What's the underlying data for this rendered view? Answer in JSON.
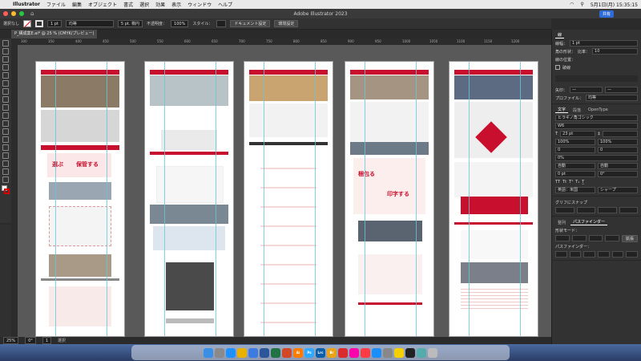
{
  "menubar": {
    "app_name": "Illustrator",
    "items": [
      "ファイル",
      "編集",
      "オブジェクト",
      "書式",
      "選択",
      "効果",
      "表示",
      "ウィンドウ",
      "ヘルプ"
    ],
    "clock": "5月1日(月) 15:35:15"
  },
  "window": {
    "title": "Adobe Illustrator 2023",
    "share_label": "共有"
  },
  "control_bar": {
    "selection": "選択なし",
    "stroke_weight": "1 pt",
    "stroke_profile": "均等",
    "brush": "5 pt. 楕円",
    "opacity_label": "不透明度：",
    "opacity": "100%",
    "style_label": "スタイル：",
    "doc_setup": "ドキュメント設定",
    "prefs": "環境設定"
  },
  "document_tab": {
    "label": "P_構成案E.ai* @ 25 % (CMYK/プレビュー)"
  },
  "ruler_marks": [
    "300",
    "350",
    "400",
    "450",
    "500",
    "550",
    "600",
    "650",
    "700",
    "750",
    "800",
    "850",
    "900",
    "950",
    "1000",
    "1050",
    "1100",
    "1150",
    "1200"
  ],
  "artboards": [
    {
      "name": "artboard-1",
      "headline": "選ぶ",
      "sub": "保管する"
    },
    {
      "name": "artboard-2",
      "headline": "",
      "sub": ""
    },
    {
      "name": "artboard-3",
      "headline": "",
      "sub": ""
    },
    {
      "name": "artboard-4",
      "headline": "梱包る",
      "sub": "印字する"
    },
    {
      "name": "artboard-5",
      "headline": "",
      "sub": ""
    }
  ],
  "status_bar": {
    "zoom": "25%",
    "rotation": "0°",
    "artboard_num": "1",
    "tool": "選択"
  },
  "right_panel": {
    "stroke": {
      "tab": "線",
      "weight_label": "線幅：",
      "weight": "1 pt",
      "corner_label": "角の形状：",
      "miter": "比率：",
      "miter_value": "10",
      "align_label": "線の位置：",
      "dash_label": "破線",
      "arrow_label": "矢印：",
      "profile_label": "プロファイル：",
      "profile": "均等"
    },
    "character": {
      "tabs": [
        "文字",
        "段落",
        "OpenType"
      ],
      "font": "ヒラギノ角ゴシック",
      "style": "W6",
      "size": "23 pt",
      "scale_h": "100%",
      "scale_v": "100%",
      "tracking": "0",
      "leading": "自動",
      "kerning": "0%",
      "baseline": "0 pt",
      "rotation": "0°",
      "language": "英語：米国",
      "aa": "シャープ",
      "auto": "自動"
    },
    "snap": {
      "label": "グリフにスナップ"
    },
    "pathfinder": {
      "tabs": [
        "整列",
        "パスファインダー"
      ],
      "shape_modes_label": "形状モード：",
      "pathfinders_label": "パスファインダー：",
      "expand": "拡張"
    }
  },
  "dock": {
    "apps": [
      "Finder",
      "Launchpad",
      "Safari",
      "Chrome",
      "Mail",
      "Word",
      "Excel",
      "PowerPoint",
      "Ai",
      "Ps",
      "Lrc",
      "Br",
      "Acrobat",
      "Photos",
      "Music",
      "App Store",
      "Settings",
      "Notes",
      "Terminal",
      "Preview",
      "Trash"
    ]
  },
  "colors": {
    "accent_red": "#c8102e",
    "dark_gray": "#595959",
    "guide_cyan": "#65c7d8",
    "mac_blue": "#2d6bd8"
  }
}
